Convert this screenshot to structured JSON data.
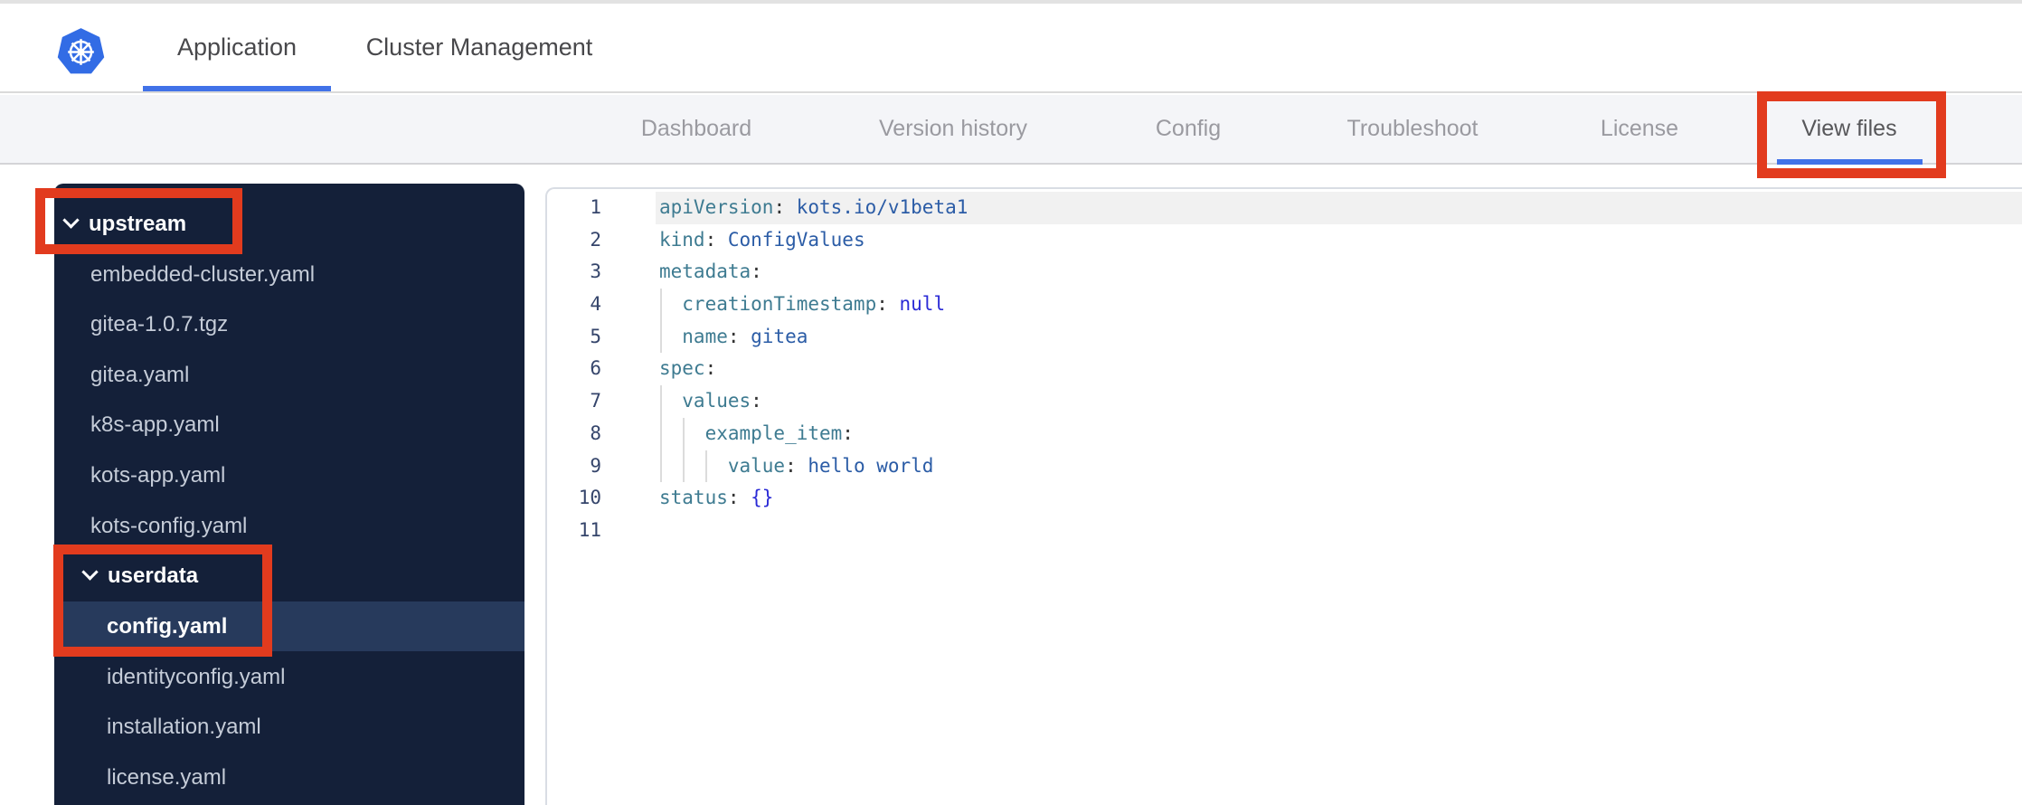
{
  "header": {
    "tabs": [
      {
        "label": "Application"
      },
      {
        "label": "Cluster Management"
      }
    ],
    "active_tab": "Application"
  },
  "subnav": {
    "tabs": [
      {
        "label": "Dashboard"
      },
      {
        "label": "Version history"
      },
      {
        "label": "Config"
      },
      {
        "label": "Troubleshoot"
      },
      {
        "label": "License"
      },
      {
        "label": "View files"
      }
    ],
    "active_tab": "View files"
  },
  "sidebar": {
    "items": [
      {
        "label": "upstream",
        "type": "folder",
        "expanded": true
      },
      {
        "label": "embedded-cluster.yaml",
        "type": "file"
      },
      {
        "label": "gitea-1.0.7.tgz",
        "type": "file"
      },
      {
        "label": "gitea.yaml",
        "type": "file"
      },
      {
        "label": "k8s-app.yaml",
        "type": "file"
      },
      {
        "label": "kots-app.yaml",
        "type": "file"
      },
      {
        "label": "kots-config.yaml",
        "type": "file"
      },
      {
        "label": "userdata",
        "type": "folder",
        "expanded": true
      },
      {
        "label": "config.yaml",
        "type": "file",
        "selected": true
      },
      {
        "label": "identityconfig.yaml",
        "type": "file"
      },
      {
        "label": "installation.yaml",
        "type": "file"
      },
      {
        "label": "license.yaml",
        "type": "file"
      }
    ]
  },
  "editor": {
    "lines": [
      {
        "num": "1",
        "active": true,
        "guides": 0,
        "tokens": [
          [
            "key",
            "apiVersion"
          ],
          [
            "p",
            ":"
          ],
          [
            "str",
            " kots.io/v1beta1"
          ]
        ]
      },
      {
        "num": "2",
        "guides": 0,
        "tokens": [
          [
            "key",
            "kind"
          ],
          [
            "p",
            ":"
          ],
          [
            "str",
            " ConfigValues"
          ]
        ]
      },
      {
        "num": "3",
        "guides": 0,
        "tokens": [
          [
            "key",
            "metadata"
          ],
          [
            "p",
            ":"
          ]
        ]
      },
      {
        "num": "4",
        "guides": 1,
        "tokens": [
          [
            "key",
            "  creationTimestamp"
          ],
          [
            "p",
            ":"
          ],
          [
            "const",
            " null"
          ]
        ]
      },
      {
        "num": "5",
        "guides": 1,
        "tokens": [
          [
            "key",
            "  name"
          ],
          [
            "p",
            ":"
          ],
          [
            "str",
            " gitea"
          ]
        ]
      },
      {
        "num": "6",
        "guides": 0,
        "tokens": [
          [
            "key",
            "spec"
          ],
          [
            "p",
            ":"
          ]
        ]
      },
      {
        "num": "7",
        "guides": 1,
        "tokens": [
          [
            "key",
            "  values"
          ],
          [
            "p",
            ":"
          ]
        ]
      },
      {
        "num": "8",
        "guides": 2,
        "tokens": [
          [
            "key",
            "    example_item"
          ],
          [
            "p",
            ":"
          ]
        ]
      },
      {
        "num": "9",
        "guides": 3,
        "tokens": [
          [
            "key",
            "      value"
          ],
          [
            "p",
            ":"
          ],
          [
            "str",
            " hello world"
          ]
        ]
      },
      {
        "num": "10",
        "guides": 0,
        "tokens": [
          [
            "key",
            "status"
          ],
          [
            "p",
            ":"
          ],
          [
            "const",
            " {}"
          ]
        ]
      },
      {
        "num": "11",
        "guides": 0,
        "tokens": []
      }
    ]
  },
  "annotations": [
    {
      "target": "upstream-folder"
    },
    {
      "target": "userdata-config-yaml"
    },
    {
      "target": "view-files-tab"
    }
  ],
  "colors": {
    "accent_blue": "#4172e8",
    "annotation_red": "#e23b1e",
    "sidebar_bg": "#142039",
    "selected_row_bg": "#273a5c",
    "kubernetes_blue": "#326ce5",
    "code_key_teal": "#3e7b91",
    "code_value_blue": "#2b5ca6",
    "code_const_blue": "#2a2ad6"
  }
}
